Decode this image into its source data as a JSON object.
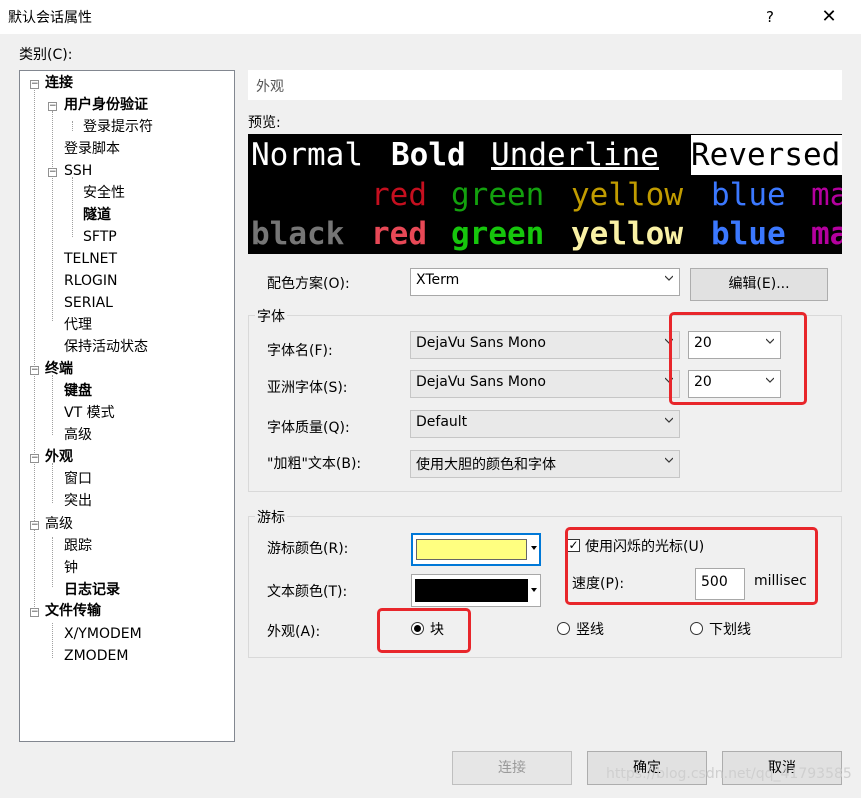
{
  "window": {
    "title": "默认会话属性",
    "help": "?",
    "close": "✕"
  },
  "category_label": "类别(C):",
  "tree": {
    "connection": "连接",
    "auth": "用户身份验证",
    "login_prompt": "登录提示符",
    "login_script": "登录脚本",
    "ssh": "SSH",
    "security": "安全性",
    "tunnel": "隧道",
    "sftp": "SFTP",
    "telnet": "TELNET",
    "rlogin": "RLOGIN",
    "serial": "SERIAL",
    "proxy": "代理",
    "keepalive": "保持活动状态",
    "terminal": "终端",
    "keyboard": "键盘",
    "vt_mode": "VT 模式",
    "advanced_term": "高级",
    "appearance": "外观",
    "window": "窗口",
    "highlight": "突出",
    "advanced": "高级",
    "trace": "跟踪",
    "bell": "钟",
    "logging": "日志记录",
    "file_transfer": "文件传输",
    "xymodem": "X/YMODEM",
    "zmodem": "ZMODEM"
  },
  "section_title": "外观",
  "preview": {
    "label": "预览:",
    "row1": {
      "normal": "Normal",
      "bold": "Bold",
      "underline": "Underline",
      "reversed": "Reversed"
    },
    "row2": [
      "red",
      "green",
      "yellow",
      "blue",
      "ma"
    ],
    "row3": [
      "black",
      "red",
      "green",
      "yellow",
      "blue",
      "ma"
    ]
  },
  "color_scheme": {
    "label": "配色方案(O):",
    "value": "XTerm",
    "edit_button": "编辑(E)..."
  },
  "font_group": {
    "title": "字体",
    "font_name_label": "字体名(F):",
    "font_name_value": "DejaVu Sans Mono",
    "font_size_value": "20",
    "asian_font_label": "亚洲字体(S):",
    "asian_font_value": "DejaVu Sans Mono",
    "asian_size_value": "20",
    "quality_label": "字体质量(Q):",
    "quality_value": "Default",
    "bold_text_label": "\"加粗\"文本(B):",
    "bold_text_value": "使用大胆的颜色和字体"
  },
  "cursor_group": {
    "title": "游标",
    "cursor_color_label": "游标颜色(R):",
    "text_color_label": "文本颜色(T):",
    "blink_checkbox_label": "使用闪烁的光标(U)",
    "speed_label": "速度(P):",
    "speed_value": "500",
    "speed_unit": "millisec",
    "appearance_label": "外观(A):",
    "shape_block": "块",
    "shape_vline": "竖线",
    "shape_underline": "下划线"
  },
  "buttons": {
    "connect": "连接",
    "ok": "确定",
    "cancel": "取消"
  },
  "watermark": "https://blog.csdn.net/qq_41793585",
  "colors": {
    "cursor_color": "#ffff80",
    "text_color": "#000000",
    "highlight_box": "#e8262b",
    "ansi_red": "#c50f1f",
    "ansi_green": "#13a10e",
    "ansi_yellow": "#c19c00",
    "ansi_blue": "#0037da",
    "ansi_magenta": "#881798",
    "bright_black": "#767676",
    "bright_red": "#e74856",
    "bright_green": "#16c60c",
    "bright_yellow": "#f9f1a5",
    "bright_blue": "#3b78ff",
    "bright_magenta": "#b4009e"
  }
}
